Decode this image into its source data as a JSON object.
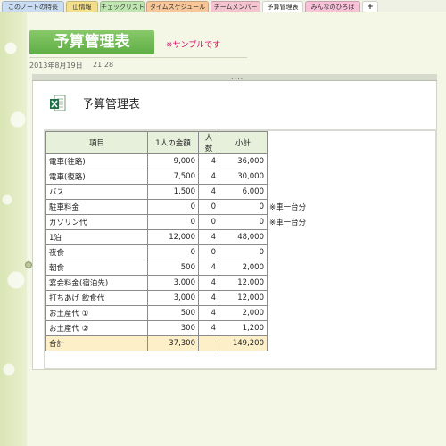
{
  "tabs": [
    {
      "label": "このノートの特長",
      "color": "#c9dcf2"
    },
    {
      "label": "山情報",
      "color": "#f4e08c"
    },
    {
      "label": "チェックリスト",
      "color": "#bfe6b0"
    },
    {
      "label": "タイムスケジュール",
      "color": "#f7c79a"
    },
    {
      "label": "チームメンバー",
      "color": "#f4c3d0"
    },
    {
      "label": "予算管理表",
      "color": "#ffffff"
    },
    {
      "label": "みんなのひろば",
      "color": "#f7c2d8"
    },
    {
      "label": "+",
      "color": "#ffffff"
    }
  ],
  "page": {
    "title": "予算管理表",
    "note": "※サンプルです",
    "date": "2013年8月19日",
    "time": "21:28",
    "accent": "#6dbb50"
  },
  "container": {
    "grip": "....",
    "icon": "excel-file-icon",
    "sheet_title": "予算管理表"
  },
  "table": {
    "headers": [
      "項目",
      "1人の金額",
      "人数",
      "小計"
    ],
    "rows": [
      {
        "item": "電車(往路)",
        "price": "9,000",
        "count": "4",
        "subtotal": "36,000",
        "note": ""
      },
      {
        "item": "電車(復路)",
        "price": "7,500",
        "count": "4",
        "subtotal": "30,000",
        "note": ""
      },
      {
        "item": "バス",
        "price": "1,500",
        "count": "4",
        "subtotal": "6,000",
        "note": ""
      },
      {
        "item": "駐車料金",
        "price": "0",
        "count": "0",
        "subtotal": "0",
        "note": "※車一台分"
      },
      {
        "item": "ガソリン代",
        "price": "0",
        "count": "0",
        "subtotal": "0",
        "note": "※車一台分"
      },
      {
        "item": "1泊",
        "price": "12,000",
        "count": "4",
        "subtotal": "48,000",
        "note": ""
      },
      {
        "item": "夜食",
        "price": "0",
        "count": "0",
        "subtotal": "0",
        "note": ""
      },
      {
        "item": "朝食",
        "price": "500",
        "count": "4",
        "subtotal": "2,000",
        "note": ""
      },
      {
        "item": "宴会料金(宿泊先)",
        "price": "3,000",
        "count": "4",
        "subtotal": "12,000",
        "note": ""
      },
      {
        "item": "打ちあげ 飲食代",
        "price": "3,000",
        "count": "4",
        "subtotal": "12,000",
        "note": ""
      },
      {
        "item": "お土産代 ①",
        "price": "500",
        "count": "4",
        "subtotal": "2,000",
        "note": ""
      },
      {
        "item": "お土産代 ②",
        "price": "300",
        "count": "4",
        "subtotal": "1,200",
        "note": ""
      }
    ],
    "total": {
      "item": "合計",
      "price": "37,300",
      "count": "",
      "subtotal": "149,200"
    }
  }
}
